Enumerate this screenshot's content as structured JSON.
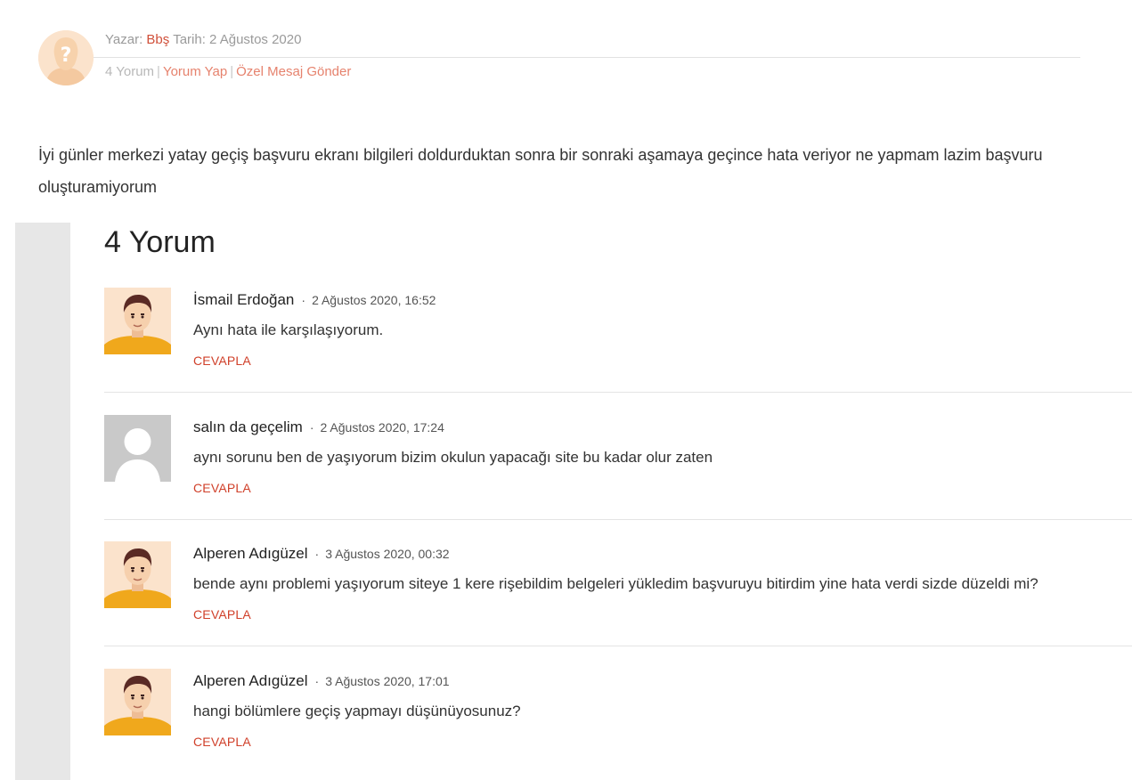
{
  "post_meta": {
    "author_prefix": "Yazar:",
    "author_name": "Bbş",
    "date_text": "Tarih: 2 Ağustos 2020",
    "comment_count_label": "4 Yorum",
    "write_comment_label": "Yorum Yap",
    "private_message_label": "Özel Mesaj Gönder",
    "separator": "|"
  },
  "question": {
    "text": "İyi günler merkezi yatay geçiş başvuru ekranı bilgileri doldurduktan sonra bir sonraki aşamaya geçince hata veriyor ne yapmam lazim başvuru oluşturamiyorum"
  },
  "comments_section": {
    "title": "4 Yorum",
    "reply_label": "CEVAPLA",
    "separator_dot": "·",
    "items": [
      {
        "author": "İsmail Erdoğan",
        "date": "2 Ağustos 2020, 16:52",
        "text": "Aynı hata ile karşılaşıyorum.",
        "avatar": "cartoon-man-avatar"
      },
      {
        "author": "salın da geçelim",
        "date": "2 Ağustos 2020, 17:24",
        "text": "aynı sorunu ben de yaşıyorum bizim okulun yapacağı site bu kadar olur zaten",
        "avatar": "default-gray-avatar"
      },
      {
        "author": "Alperen Adıgüzel",
        "date": "3 Ağustos 2020, 00:32",
        "text": "bende aynı problemi yaşıyorum siteye 1 kere rişebildim belgeleri yükledim başvuruyu bitirdim yine hata verdi sizde düzeldi mi?",
        "avatar": "cartoon-man-avatar"
      },
      {
        "author": "Alperen Adıgüzel",
        "date": "3 Ağustos 2020, 17:01",
        "text": "hangi bölümlere geçiş yapmayı düşünüyosunuz?",
        "avatar": "cartoon-man-avatar"
      }
    ]
  },
  "colors": {
    "accent": "#d0402a",
    "link_light": "#e6826d",
    "meta_gray": "#9a9a9a",
    "strip_gray": "#e7e7e7",
    "avatar_bg": "#fbe3cc",
    "shirt_yellow": "#f0a81c"
  }
}
